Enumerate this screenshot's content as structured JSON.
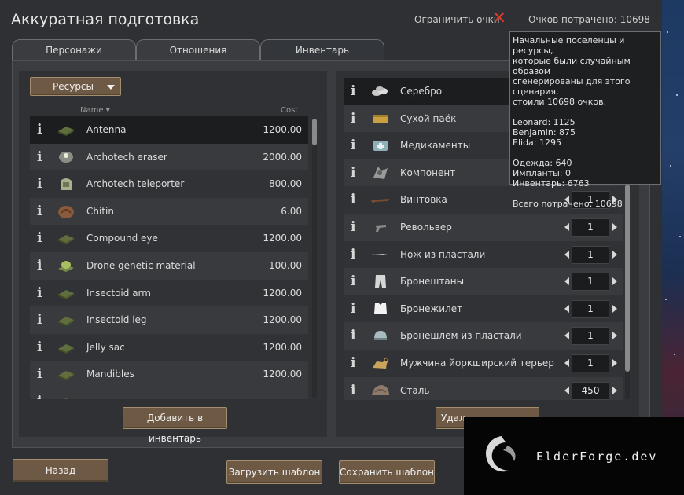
{
  "window": {
    "title": "Аккуратная подготовка",
    "limit_points_label": "Ограничить очки",
    "points_spent_label": "Очков потрачено: 10698"
  },
  "tabs": [
    {
      "label": "Персонажи",
      "active": false
    },
    {
      "label": "Отношения",
      "active": false
    },
    {
      "label": "Инвентарь",
      "active": true
    }
  ],
  "left": {
    "dropdown_label": "Ресурсы",
    "col_name": "Name",
    "col_cost": "Cost",
    "items": [
      {
        "name": "Antenna",
        "cost": "1200.00",
        "icon": "green-tile-icon"
      },
      {
        "name": "Archotech eraser",
        "cost": "2000.00",
        "icon": "archotech-eraser-icon"
      },
      {
        "name": "Archotech teleporter",
        "cost": "800.00",
        "icon": "archotech-teleporter-icon"
      },
      {
        "name": "Chitin",
        "cost": "6.00",
        "icon": "chitin-icon"
      },
      {
        "name": "Compound eye",
        "cost": "1200.00",
        "icon": "green-tile-icon"
      },
      {
        "name": "Drone genetic material",
        "cost": "100.00",
        "icon": "drone-material-icon"
      },
      {
        "name": "Insectoid arm",
        "cost": "1200.00",
        "icon": "green-tile-icon"
      },
      {
        "name": "Insectoid leg",
        "cost": "1200.00",
        "icon": "green-tile-icon"
      },
      {
        "name": "Jelly sac",
        "cost": "1200.00",
        "icon": "green-tile-icon"
      },
      {
        "name": "Mandibles",
        "cost": "1200.00",
        "icon": "green-tile-icon"
      }
    ],
    "add_button": "Добавить в инвентарь"
  },
  "right": {
    "items": [
      {
        "name": "Серебро",
        "qty": "",
        "icon": "silver-icon"
      },
      {
        "name": "Сухой паёк",
        "qty": "",
        "icon": "packaged-meal-icon"
      },
      {
        "name": "Медикаменты",
        "qty": "",
        "icon": "medicine-icon"
      },
      {
        "name": "Компонент",
        "qty": "",
        "icon": "component-icon"
      },
      {
        "name": "Винтовка",
        "qty": "1",
        "icon": "rifle-icon"
      },
      {
        "name": "Револьвер",
        "qty": "1",
        "icon": "revolver-icon"
      },
      {
        "name": "Нож из пластали",
        "qty": "1",
        "icon": "knife-icon"
      },
      {
        "name": "Бронештаны",
        "qty": "1",
        "icon": "armor-pants-icon"
      },
      {
        "name": "Бронежилет",
        "qty": "1",
        "icon": "flak-vest-icon"
      },
      {
        "name": "Бронешлем из пластали",
        "qty": "1",
        "icon": "helmet-icon"
      },
      {
        "name": "Мужчина йоркширский терьер",
        "qty": "1",
        "icon": "yorkshire-terrier-icon"
      },
      {
        "name": "Сталь",
        "qty": "450",
        "icon": "steel-icon"
      }
    ],
    "remove_button": "Удал"
  },
  "tooltip": {
    "intro": "Начальные поселенцы и ресурсы,\nкоторые были случайным образом\nсгенерированы для этого сценария,\nстоили 10698 очков.",
    "colonists": "Leonard: 1125\nBenjamin: 875\nElida: 1295",
    "categories": "Одежда: 640\nИмпланты: 0\nИнвентарь: 6763",
    "total": "Всего потрачено: 10698"
  },
  "bottom": {
    "back_button": "Назад",
    "load_button": "Загрузить шаблон",
    "save_button": "Сохранить шаблон"
  },
  "watermark": {
    "text": "ElderForge.dev"
  },
  "colors": {
    "accent_button": "#6e5a44",
    "close_x": "#e03a2f",
    "selected_row": "#1c1d1f"
  }
}
